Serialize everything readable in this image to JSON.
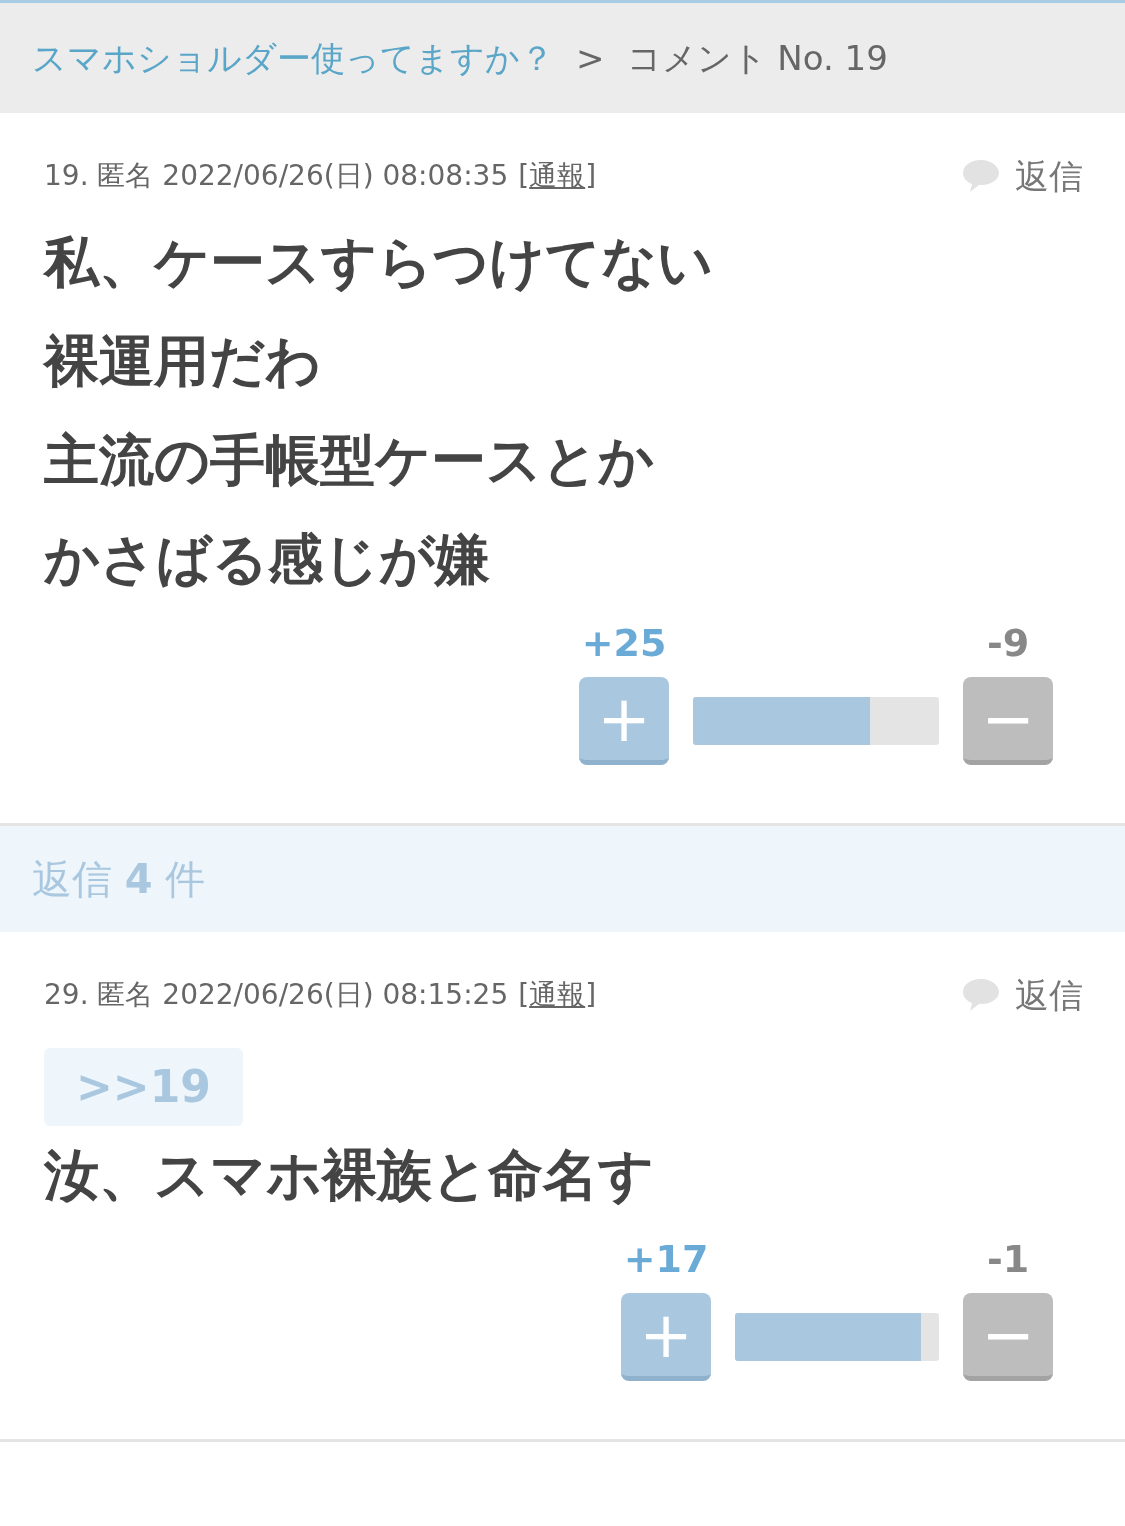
{
  "breadcrumb": {
    "link": "スマホショルダー使ってますか？",
    "separator": ">",
    "current": "コメント No. 19"
  },
  "comments": [
    {
      "meta": "19. 匿名 2022/06/26(日) 08:08:35",
      "report_open": "[",
      "report": "通報",
      "report_close": "]",
      "reply": "返信",
      "replies_band": "返信 **4** 件",
      "body": [
        "私、ケースすらつけてない",
        "裸運用だわ",
        "主流の手帳型ケースとか",
        "かさばる感じが嫌"
      ],
      "plus_count": "+25",
      "minus_count": "-9",
      "plus": "+",
      "minus": "−",
      "level": 0.72
    },
    {
      "meta": "29. 匿名 2022/06/26(日) 08:15:25",
      "report_open": "[",
      "report": "通報",
      "report_close": "]",
      "reply": "返信",
      "anchor": ">>19",
      "body": [
        "汝、スマホ裸族と命名す"
      ],
      "plus_count": "+17",
      "minus_count": "-1",
      "plus": "+",
      "minus": "−",
      "level": 0.91
    }
  ]
}
